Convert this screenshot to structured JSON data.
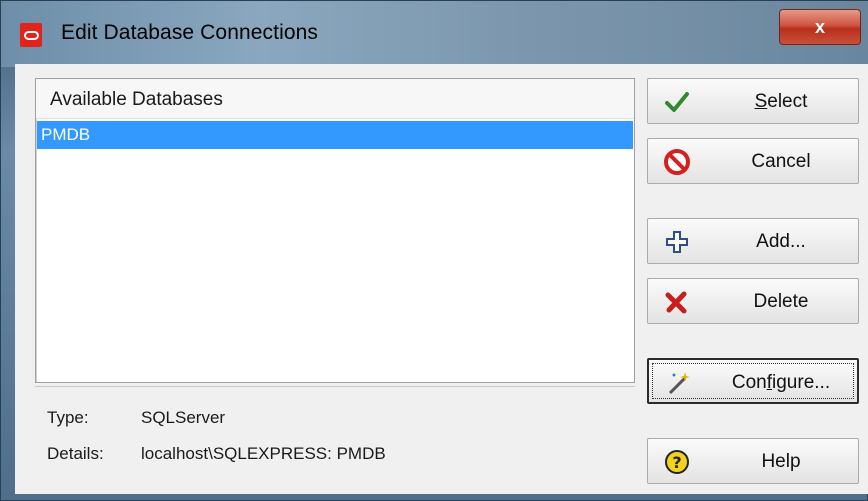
{
  "window": {
    "title": "Edit Database Connections",
    "close_glyph": "x"
  },
  "list": {
    "header": "Available Databases",
    "items": [
      {
        "name": "PMDB",
        "selected": true
      }
    ]
  },
  "info": {
    "type_label": "Type:",
    "type_value": "SQLServer",
    "details_label": "Details:",
    "details_value": "localhost\\SQLEXPRESS: PMDB"
  },
  "buttons": {
    "select": {
      "label_u": "S",
      "label_rest": "elect",
      "icon": "checkmark-icon"
    },
    "cancel": {
      "label": "Cancel",
      "icon": "no-entry-icon"
    },
    "add": {
      "label": "Add...",
      "icon": "plus-icon"
    },
    "delete": {
      "label": "Delete",
      "icon": "red-x-icon"
    },
    "configure": {
      "label_pre": "Con",
      "label_u": "f",
      "label_rest": "igure...",
      "icon": "magic-wand-icon"
    },
    "help": {
      "label": "Help",
      "icon": "help-icon"
    }
  },
  "colors": {
    "selection": "#3399ff",
    "close_button": "#c9503a",
    "app_icon": "#e0241c"
  }
}
